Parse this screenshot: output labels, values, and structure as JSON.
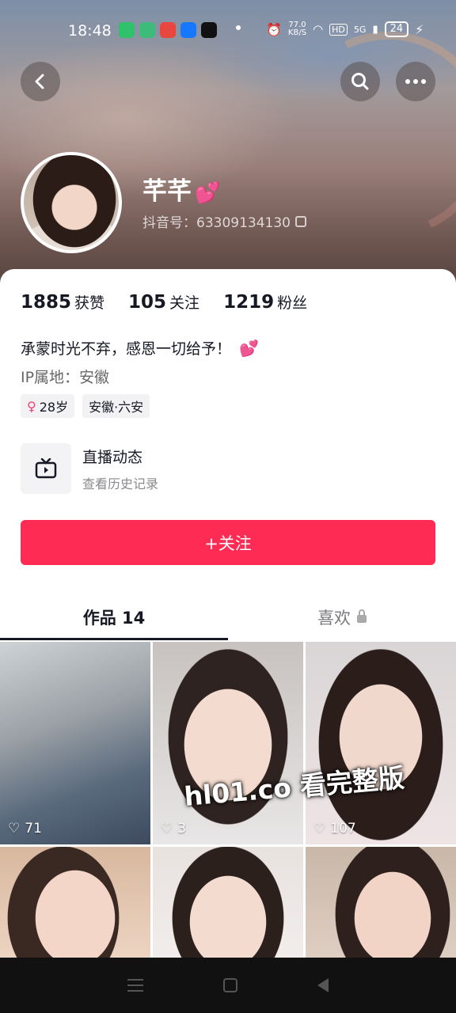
{
  "status_bar": {
    "time": "18:48",
    "net_speed": "77.0",
    "net_unit": "KB/S",
    "hd": "HD",
    "signal": "5G",
    "battery": "24"
  },
  "profile": {
    "name": "芊芊",
    "name_emoji": "💕",
    "douyin_id": "抖音号：63309134130"
  },
  "stats": [
    {
      "num": "1885",
      "label": "获赞"
    },
    {
      "num": "105",
      "label": "关注"
    },
    {
      "num": "1219",
      "label": "粉丝"
    }
  ],
  "bio": "承蒙时光不弃，感恩一切给予！",
  "bio_emoji": "💕",
  "ip": "IP属地：安徽",
  "tags": {
    "gender_symbol": "♀",
    "age": "28岁",
    "location": "安徽·六安"
  },
  "live": {
    "title": "直播动态",
    "subtitle": "查看历史记录"
  },
  "follow_button": "+关注",
  "tabs": {
    "works": "作品 14",
    "likes": "喜欢"
  },
  "videos": [
    {
      "likes": "71"
    },
    {
      "likes": "3"
    },
    {
      "likes": "107"
    },
    {
      "likes": ""
    },
    {
      "likes": ""
    },
    {
      "likes": ""
    }
  ],
  "watermark": "hl01.co 看完整版",
  "colors": {
    "accent": "#fe2c55",
    "text": "#161823",
    "secondary": "#8a8a8f"
  }
}
